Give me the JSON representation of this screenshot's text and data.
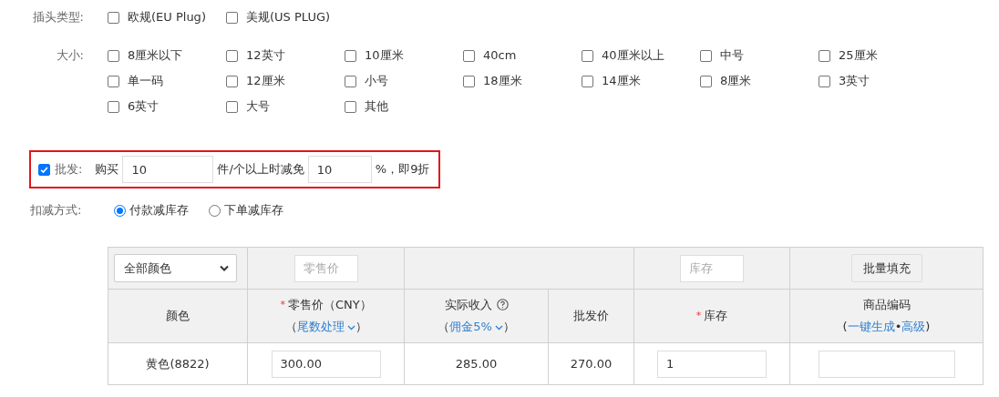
{
  "plug_type": {
    "label": "插头类型:",
    "options": [
      {
        "label": "欧规(EU Plug)",
        "checked": false
      },
      {
        "label": "美规(US PLUG)",
        "checked": false
      }
    ]
  },
  "size": {
    "label": "大小:",
    "options": [
      {
        "label": "8厘米以下",
        "checked": false
      },
      {
        "label": "12英寸",
        "checked": false
      },
      {
        "label": "10厘米",
        "checked": false
      },
      {
        "label": "40cm",
        "checked": false
      },
      {
        "label": "40厘米以上",
        "checked": false
      },
      {
        "label": "中号",
        "checked": false
      },
      {
        "label": "25厘米",
        "checked": false
      },
      {
        "label": "单一码",
        "checked": false
      },
      {
        "label": "12厘米",
        "checked": false
      },
      {
        "label": "小号",
        "checked": false
      },
      {
        "label": "18厘米",
        "checked": false
      },
      {
        "label": "14厘米",
        "checked": false
      },
      {
        "label": "8厘米",
        "checked": false
      },
      {
        "label": "3英寸",
        "checked": false
      },
      {
        "label": "6英寸",
        "checked": false
      },
      {
        "label": "大号",
        "checked": false
      },
      {
        "label": "其他",
        "checked": false
      }
    ]
  },
  "wholesale": {
    "checked": true,
    "label": "批发:",
    "buy_label": "购买",
    "quantity": "10",
    "mid_label": "件/个以上时减免",
    "percent": "10",
    "suffix": "%，即9折"
  },
  "deduction": {
    "label": "扣减方式:",
    "options": [
      {
        "label": "付款减库存",
        "selected": true
      },
      {
        "label": "下单减库存",
        "selected": false
      }
    ]
  },
  "table": {
    "toolbar": {
      "color_select": "全部颜色",
      "retail_placeholder": "零售价",
      "stock_placeholder": "库存",
      "batch_button": "批量填充"
    },
    "headers": [
      {
        "title": "颜色"
      },
      {
        "required_mark": "*",
        "title": "零售价（CNY）",
        "sub": [
          {
            "kind": "text",
            "text": "（"
          },
          {
            "kind": "dropdown",
            "text": "尾数处理"
          },
          {
            "kind": "text",
            "text": "）"
          }
        ]
      },
      {
        "title": "实际收入",
        "help": true,
        "sub": [
          {
            "kind": "text",
            "text": "（"
          },
          {
            "kind": "dropdown",
            "text": "佣金5%"
          },
          {
            "kind": "text",
            "text": "）"
          }
        ]
      },
      {
        "title": "批发价"
      },
      {
        "required_mark": "*",
        "title": "库存"
      },
      {
        "title": "商品编码",
        "sub": [
          {
            "kind": "text",
            "text": "("
          },
          {
            "kind": "link",
            "text": "一键生成"
          },
          {
            "kind": "text",
            "text": "•"
          },
          {
            "kind": "link",
            "text": "高级"
          },
          {
            "kind": "text",
            "text": ")"
          }
        ]
      }
    ],
    "rows": [
      {
        "color_name": "黄色(8822)",
        "retail": "300.00",
        "income": "285.00",
        "wholesale_price": "270.00",
        "stock": "1"
      }
    ]
  }
}
